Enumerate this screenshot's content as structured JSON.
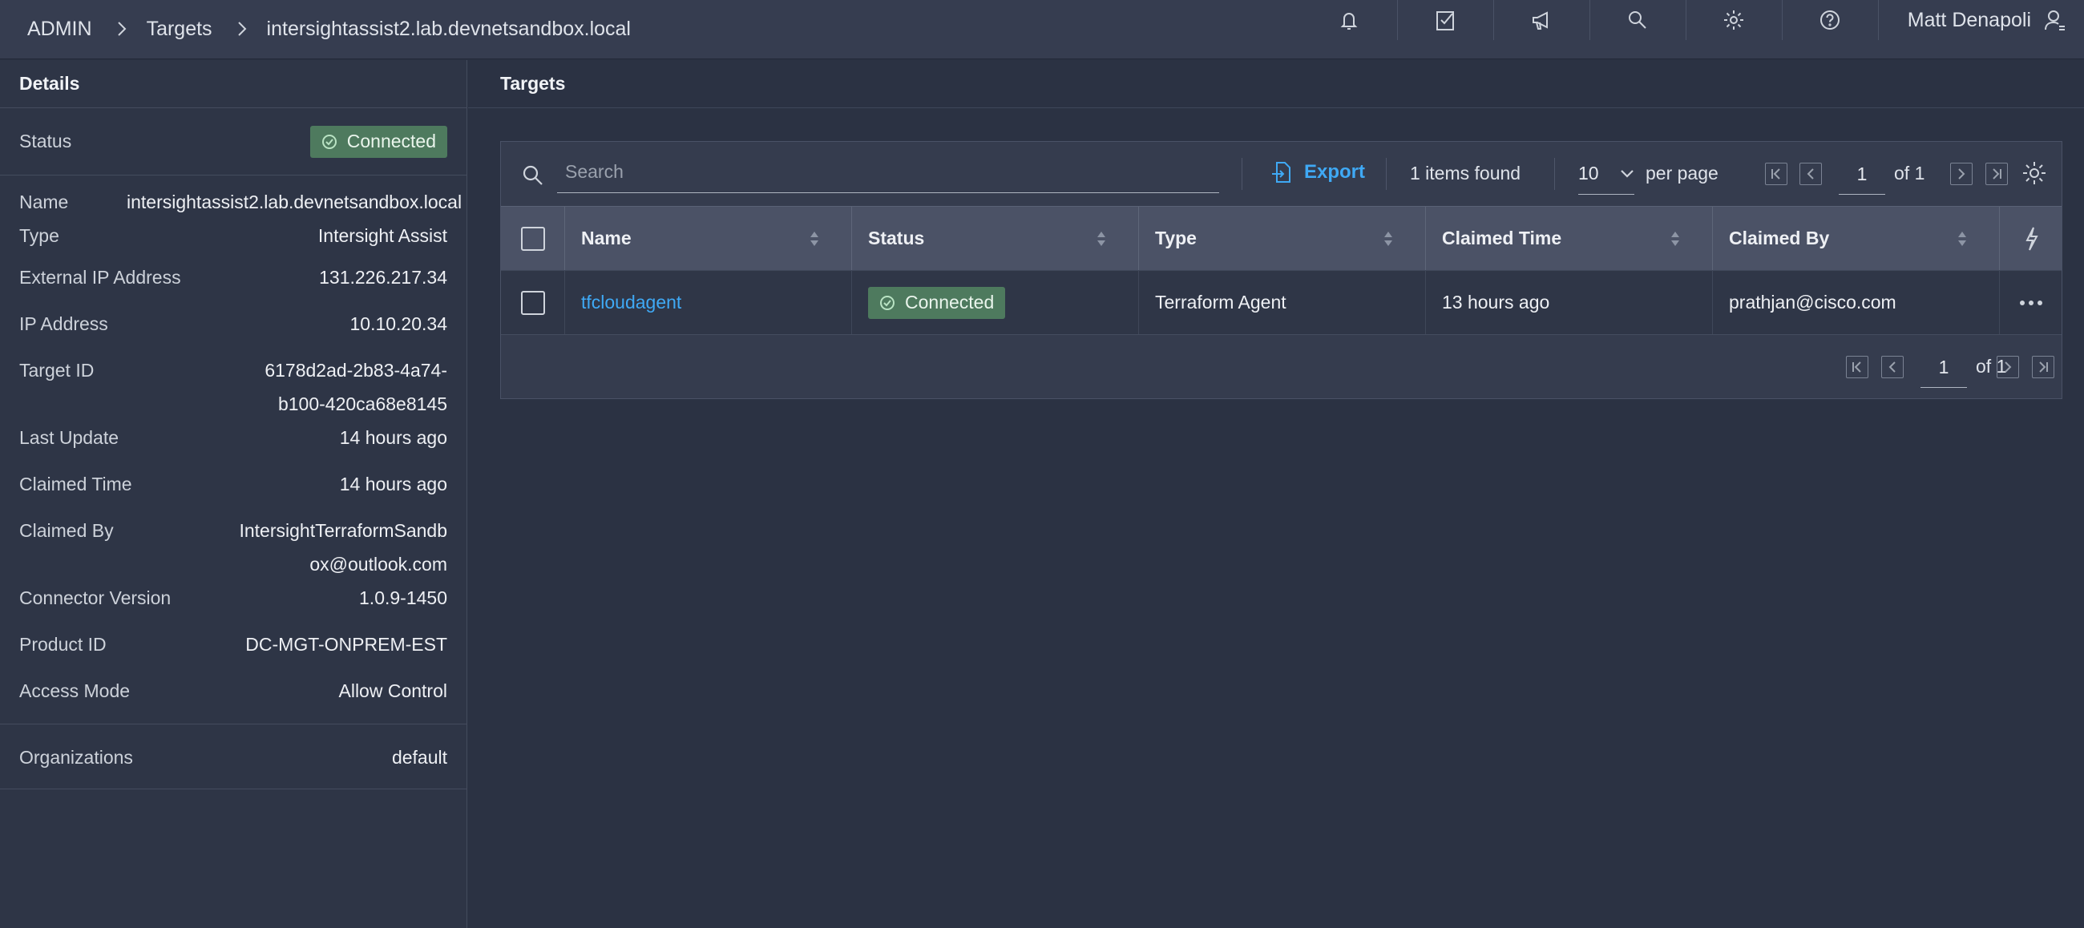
{
  "breadcrumb": {
    "items": [
      "ADMIN",
      "Targets",
      "intersightassist2.lab.devnetsandbox.local"
    ]
  },
  "topbar": {
    "icons": [
      "bell-icon",
      "checklist-icon",
      "megaphone-icon",
      "search-icon",
      "gear-icon",
      "help-icon"
    ],
    "user_name": "Matt Denapoli"
  },
  "details": {
    "title": "Details",
    "status_label": "Status",
    "status_value": "Connected",
    "status_color": "#4e7a5e",
    "fields": [
      {
        "label": "Name",
        "value": "intersightassist2.lab.devnetsandbox.local"
      },
      {
        "label": "Type",
        "value": "Intersight Assist"
      },
      {
        "label": "External IP Address",
        "value": "131.226.217.34"
      },
      {
        "label": "IP Address",
        "value": "10.10.20.34"
      },
      {
        "label": "Target ID",
        "value": "6178d2ad-2b83-4a74-b100-420ca68e8145"
      },
      {
        "label": "Last Update",
        "value": "14 hours ago"
      },
      {
        "label": "Claimed Time",
        "value": "14 hours ago"
      },
      {
        "label": "Claimed By",
        "value": "IntersightTerraformSandbox@outlook.com"
      },
      {
        "label": "Connector Version",
        "value": "1.0.9-1450"
      },
      {
        "label": "Product ID",
        "value": "DC-MGT-ONPREM-EST"
      },
      {
        "label": "Access Mode",
        "value": "Allow Control"
      }
    ],
    "organizations_label": "Organizations",
    "organizations_value": "default"
  },
  "targets": {
    "title": "Targets",
    "search_placeholder": "Search",
    "export_label": "Export",
    "items_found": "1 items found",
    "per_page_value": "10",
    "per_page_label": "per page",
    "page_current": "1",
    "page_of": "of 1",
    "accent_color": "#3fa9f5",
    "columns": [
      "Name",
      "Status",
      "Type",
      "Claimed Time",
      "Claimed By"
    ],
    "rows": [
      {
        "name": "tfcloudagent",
        "status": "Connected",
        "type": "Terraform Agent",
        "claimed_time": "13 hours ago",
        "claimed_by": "prathjan@cisco.com"
      }
    ]
  }
}
